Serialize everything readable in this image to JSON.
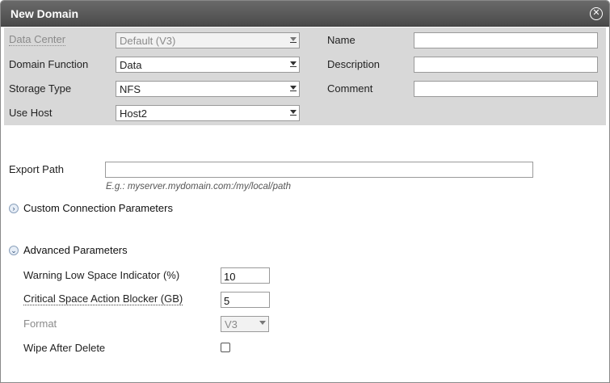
{
  "dialog": {
    "title": "New Domain",
    "close_icon": "close-icon"
  },
  "general": {
    "data_center": {
      "label": "Data Center",
      "value": "Default (V3)"
    },
    "domain_function": {
      "label": "Domain Function",
      "value": "Data"
    },
    "storage_type": {
      "label": "Storage Type",
      "value": "NFS"
    },
    "use_host": {
      "label": "Use Host",
      "value": "Host2"
    },
    "name": {
      "label": "Name",
      "value": ""
    },
    "description": {
      "label": "Description",
      "value": ""
    },
    "comment": {
      "label": "Comment",
      "value": ""
    }
  },
  "export": {
    "label": "Export Path",
    "value": "",
    "hint": "E.g.: myserver.mydomain.com:/my/local/path"
  },
  "custom_connection": {
    "label": "Custom Connection Parameters",
    "icon": "chevron-right-icon"
  },
  "advanced": {
    "label": "Advanced Parameters",
    "icon": "chevron-down-icon",
    "warning_low_space": {
      "label": "Warning Low Space Indicator (%)",
      "value": "10"
    },
    "critical_space": {
      "label": "Critical Space Action Blocker (GB)",
      "value": "5"
    },
    "format": {
      "label": "Format",
      "value": "V3"
    },
    "wipe_after_delete": {
      "label": "Wipe After Delete",
      "checked": false
    }
  }
}
